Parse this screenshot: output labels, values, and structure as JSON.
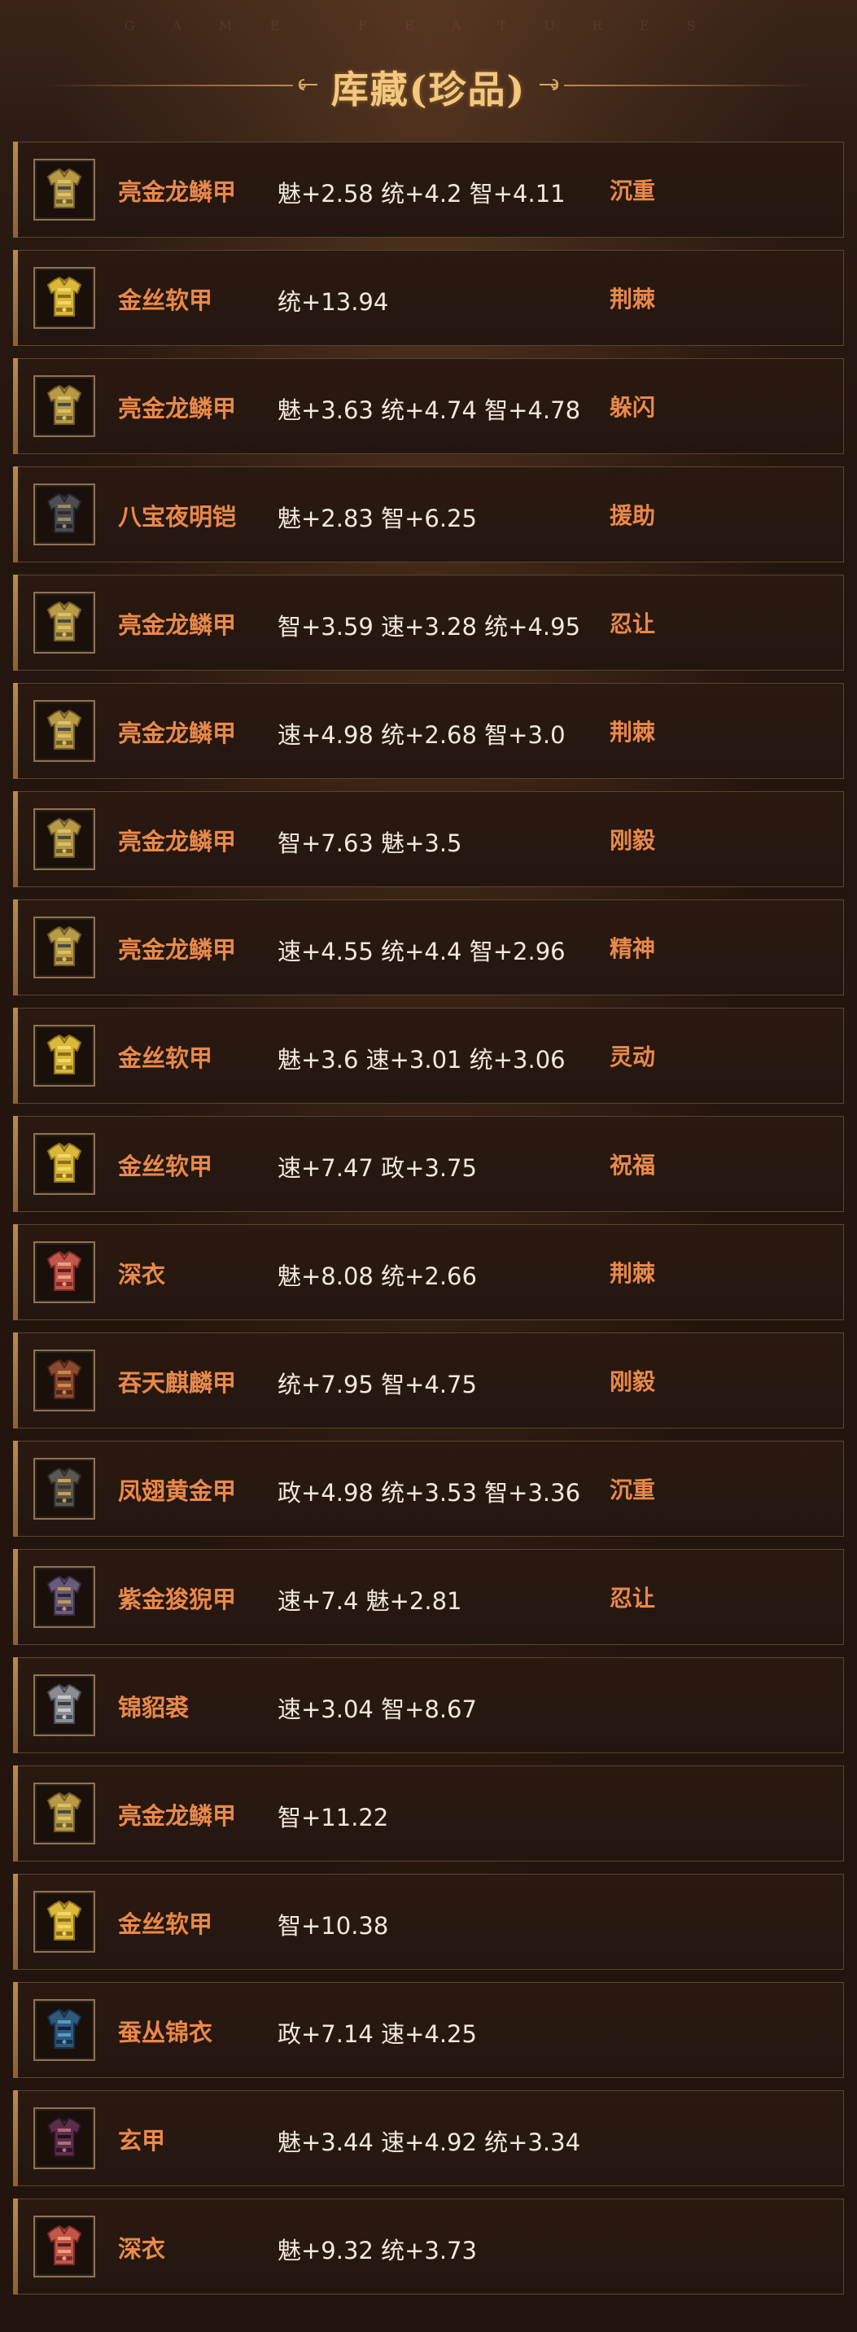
{
  "header": {
    "caption": "GAME FEATURES",
    "title": "库藏(珍品)"
  },
  "items": [
    {
      "name": "亮金龙鳞甲",
      "stats": "魅+2.58 统+4.2 智+4.11",
      "trait": "沉重",
      "icon": "golden-dragon-scale-armor-icon"
    },
    {
      "name": "金丝软甲",
      "stats": "统+13.94",
      "trait": "荆棘",
      "icon": "gold-silk-armor-icon"
    },
    {
      "name": "亮金龙鳞甲",
      "stats": "魅+3.63 统+4.74 智+4.78",
      "trait": "躲闪",
      "icon": "golden-dragon-scale-armor-icon"
    },
    {
      "name": "八宝夜明铠",
      "stats": "魅+2.83 智+6.25",
      "trait": "援助",
      "icon": "dark-plate-armor-icon"
    },
    {
      "name": "亮金龙鳞甲",
      "stats": "智+3.59 速+3.28 统+4.95",
      "trait": "忍让",
      "icon": "golden-dragon-scale-armor-icon"
    },
    {
      "name": "亮金龙鳞甲",
      "stats": "速+4.98 统+2.68 智+3.0",
      "trait": "荆棘",
      "icon": "golden-dragon-scale-armor-icon"
    },
    {
      "name": "亮金龙鳞甲",
      "stats": "智+7.63 魅+3.5",
      "trait": "刚毅",
      "icon": "golden-dragon-scale-armor-icon"
    },
    {
      "name": "亮金龙鳞甲",
      "stats": "速+4.55 统+4.4 智+2.96",
      "trait": "精神",
      "icon": "golden-dragon-scale-armor-icon"
    },
    {
      "name": "金丝软甲",
      "stats": "魅+3.6 速+3.01 统+3.06",
      "trait": "灵动",
      "icon": "gold-silk-armor-icon"
    },
    {
      "name": "金丝软甲",
      "stats": "速+7.47 政+3.75",
      "trait": "祝福",
      "icon": "gold-silk-armor-icon"
    },
    {
      "name": "深衣",
      "stats": "魅+8.08 统+2.66",
      "trait": "荆棘",
      "icon": "red-robe-icon"
    },
    {
      "name": "吞天麒麟甲",
      "stats": "统+7.95 智+4.75",
      "trait": "刚毅",
      "icon": "qilin-armor-icon"
    },
    {
      "name": "凤翅黄金甲",
      "stats": "政+4.98 统+3.53 智+3.36",
      "trait": "沉重",
      "icon": "phoenix-gold-armor-icon"
    },
    {
      "name": "紫金狻猊甲",
      "stats": "速+7.4 魅+2.81",
      "trait": "忍让",
      "icon": "purple-gold-armor-icon"
    },
    {
      "name": "锦貂裘",
      "stats": "速+3.04 智+8.67",
      "trait": "",
      "icon": "sable-fur-coat-icon"
    },
    {
      "name": "亮金龙鳞甲",
      "stats": "智+11.22",
      "trait": "",
      "icon": "golden-dragon-scale-armor-icon"
    },
    {
      "name": "金丝软甲",
      "stats": "智+10.38",
      "trait": "",
      "icon": "gold-silk-armor-icon"
    },
    {
      "name": "蚕丛锦衣",
      "stats": "政+7.14 速+4.25",
      "trait": "",
      "icon": "blue-brocade-robe-icon"
    },
    {
      "name": "玄甲",
      "stats": "魅+3.44 速+4.92 统+3.34",
      "trait": "",
      "icon": "dark-purple-armor-icon"
    },
    {
      "name": "深衣",
      "stats": "魅+9.32 统+3.73",
      "trait": "",
      "icon": "red-robe-icon"
    }
  ],
  "colors": {
    "background": "#24150e",
    "title": "#f3c87e",
    "item_name": "#e9894a",
    "stats_text": "#f2e8dc",
    "row_border": "#5a4530",
    "accent_bar": "#b78a4f"
  }
}
